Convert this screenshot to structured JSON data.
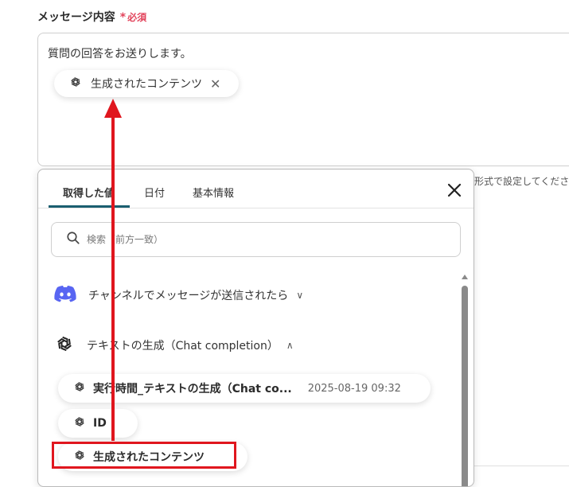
{
  "field": {
    "label": "メッセージ内容",
    "required_mark": "*",
    "required_text": "必須",
    "message_text": "質問の回答をお送りします。",
    "token_label": "生成されたコンテンツ",
    "close_icon": "✕",
    "hint_text": "形式で設定してください"
  },
  "popup": {
    "tabs": [
      {
        "label": "取得した値"
      },
      {
        "label": "日付"
      },
      {
        "label": "基本情報"
      }
    ],
    "search_placeholder": "検索（前方一致）",
    "groups": [
      {
        "label": "チャンネルでメッセージが送信されたら",
        "icon": "discord-icon",
        "chevron": "∨",
        "color": "#5865F2"
      },
      {
        "label": "テキストの生成（Chat completion）",
        "icon": "openai-icon",
        "chevron": "∧"
      }
    ],
    "items": [
      {
        "label": "実行時間_テキストの生成（Chat co...",
        "time": "2025-08-19 09:32"
      },
      {
        "label": "ID"
      },
      {
        "label": "生成されたコンテンツ"
      }
    ]
  },
  "colors": {
    "accent": "#1b5f70",
    "required": "#e2445c",
    "annotation": "#e0161e"
  }
}
